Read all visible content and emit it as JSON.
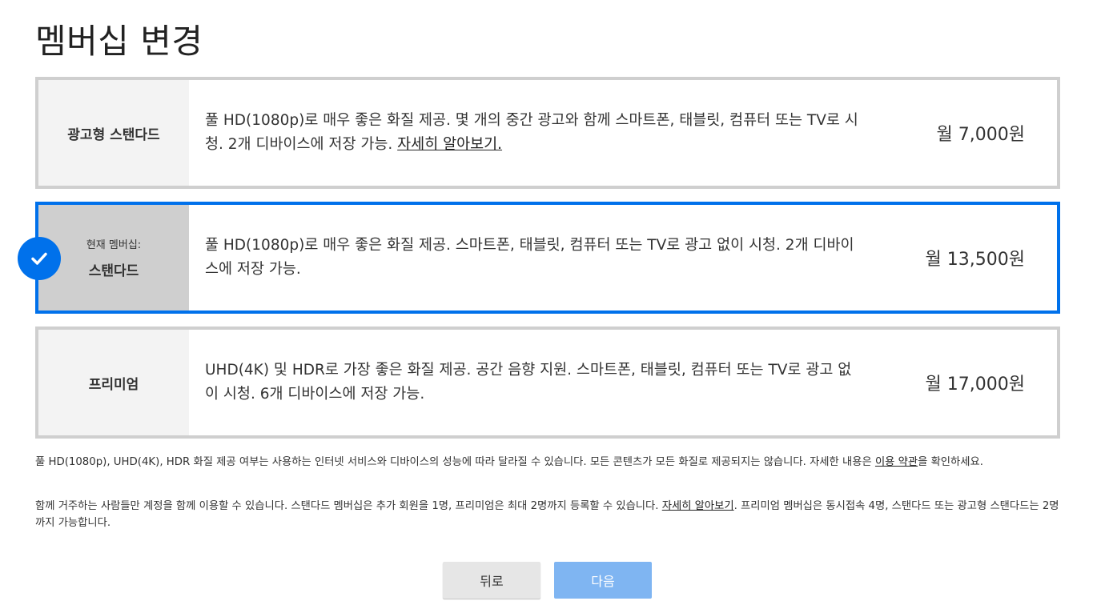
{
  "page": {
    "title": "멤버십 변경"
  },
  "plans": [
    {
      "name": "광고형 스탠다드",
      "current_label": "",
      "desc_text": "풀 HD(1080p)로 매우 좋은 화질 제공. 몇 개의 중간 광고와 함께 스마트폰, 태블릿, 컴퓨터 또는 TV로 시청. 2개 디바이스에 저장 가능. ",
      "desc_link": "자세히 알아보기.",
      "price": "월 7,000원",
      "selected": false
    },
    {
      "name": "스탠다드",
      "current_label": "현재 멤버십:",
      "desc_text": "풀 HD(1080p)로 매우 좋은 화질 제공. 스마트폰, 태블릿, 컴퓨터 또는 TV로 광고 없이 시청. 2개 디바이스에 저장 가능.",
      "desc_link": "",
      "price": "월 13,500원",
      "selected": true
    },
    {
      "name": "프리미엄",
      "current_label": "",
      "desc_text": "UHD(4K) 및 HDR로 가장 좋은 화질 제공. 공간 음향 지원. 스마트폰, 태블릿, 컴퓨터 또는 TV로 광고 없이 시청. 6개 디바이스에 저장 가능.",
      "desc_link": "",
      "price": "월 17,000원",
      "selected": false
    }
  ],
  "notes": {
    "note1_text": "풀 HD(1080p), UHD(4K), HDR 화질 제공 여부는 사용하는 인터넷 서비스와 디바이스의 성능에 따라 달라질 수 있습니다. 모든 콘텐츠가 모든 화질로 제공되지는 않습니다. 자세한 내용은 ",
    "note1_link": "이용 약관",
    "note1_after": "을 확인하세요.",
    "note2_text": "함께 거주하는 사람들만 계정을 함께 이용할 수 있습니다. 스탠다드 멤버십은 추가 회원을 1명, 프리미엄은 최대 2명까지 등록할 수 있습니다. ",
    "note2_link": "자세히 알아보기",
    "note2_after": ". 프리미엄 멤버십은 동시접속 4명, 스탠다드 또는 광고형 스탠다드는 2명까지 가능합니다."
  },
  "buttons": {
    "back_label": "뒤로",
    "next_label": "다음"
  },
  "icons": {
    "selected_check": "check-icon"
  },
  "colors": {
    "accent": "#0071eb",
    "next_button": "#7fb5f2",
    "border": "#cfcfcf"
  }
}
